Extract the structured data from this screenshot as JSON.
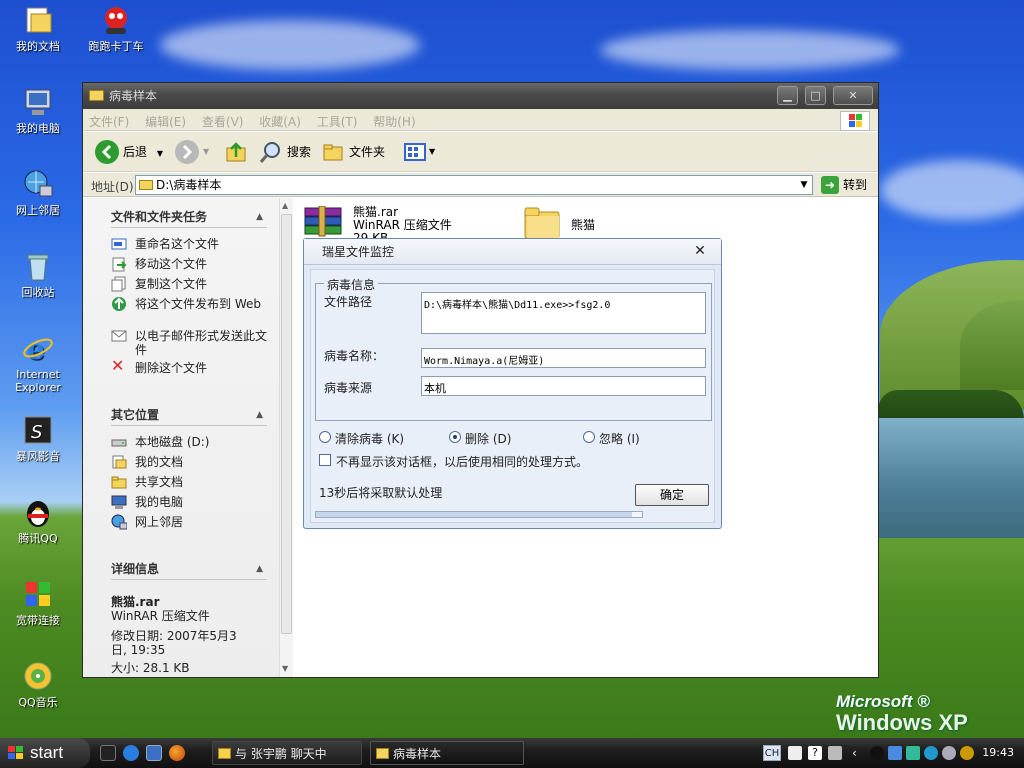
{
  "desktop": {
    "icons": [
      {
        "label": "我的文档"
      },
      {
        "label": "跑跑卡丁车"
      },
      {
        "label": "我的电脑"
      },
      {
        "label": "网上邻居"
      },
      {
        "label": "回收站"
      },
      {
        "label": "Internet Explorer"
      },
      {
        "label": "暴风影音"
      },
      {
        "label": "腾讯QQ"
      },
      {
        "label": "宽带连接"
      },
      {
        "label": "QQ音乐"
      }
    ],
    "logo": {
      "brand": "Microsoft ®",
      "product": "Windows XP"
    }
  },
  "explorer": {
    "title": "病毒样本",
    "controls": {
      "minimize": "▁",
      "maximize": "□",
      "close": "✕"
    },
    "menu": [
      "文件(F)",
      "编辑(E)",
      "查看(V)",
      "收藏(A)",
      "工具(T)",
      "帮助(H)"
    ],
    "toolbar": {
      "back": "后退",
      "search": "搜索",
      "folders": "文件夹"
    },
    "address": {
      "label": "地址(D)",
      "value": "D:\\病毒样本",
      "go": "转到"
    },
    "tasks": {
      "file_tasks_title": "文件和文件夹任务",
      "file_tasks": [
        "重命名这个文件",
        "移动这个文件",
        "复制这个文件",
        "将这个文件发布到 Web",
        "以电子邮件形式发送此文件",
        "删除这个文件"
      ],
      "other_places_title": "其它位置",
      "other_places": [
        "本地磁盘 (D:)",
        "我的文档",
        "共享文档",
        "我的电脑",
        "网上邻居"
      ],
      "details_title": "详细信息",
      "details": {
        "name": "熊猫.rar",
        "type": "WinRAR 压缩文件",
        "modified": "修改日期: 2007年5月3日, 19:35",
        "size": "大小: 28.1 KB"
      }
    },
    "files": [
      {
        "name": "熊猫.rar",
        "type": "WinRAR 压缩文件",
        "size": "29 KB"
      },
      {
        "name": "熊猫"
      }
    ]
  },
  "dialog": {
    "title": "瑞星文件监控",
    "close": "✕",
    "group_title": "病毒信息",
    "path_label": "文件路径",
    "path_value": "D:\\病毒样本\\熊猫\\Dd11.exe>>fsg2.0",
    "name_label": "病毒名称：",
    "name_value": "Worm.Nimaya.a(尼姆亚)",
    "source_label": "病毒来源",
    "source_value": "本机",
    "options": [
      {
        "label": "清除病毒 (K)",
        "selected": false
      },
      {
        "label": "删除 (D)",
        "selected": true
      },
      {
        "label": "忽略 (I)",
        "selected": false
      }
    ],
    "checkbox_label": "不再显示该对话框，以后使用相同的处理方式。",
    "countdown": "13秒后将采取默认处理",
    "ok": "确定",
    "progress": 0.97
  },
  "taskbar": {
    "start": "start",
    "tasks": [
      {
        "label": "与 张宇鹏 聊天中"
      },
      {
        "label": "病毒样本"
      }
    ],
    "lang": "CH",
    "clock": "19:43"
  }
}
